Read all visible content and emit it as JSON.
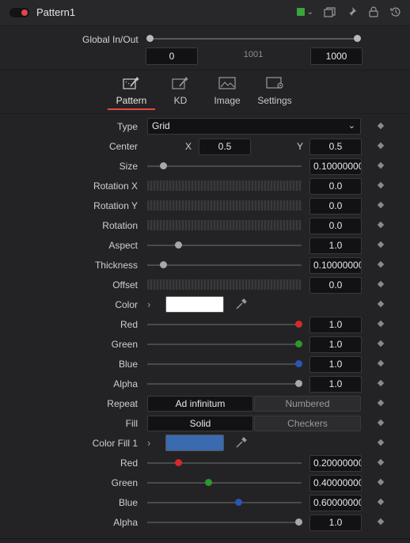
{
  "header": {
    "title": "Pattern1",
    "accent_color": "#3aa53a"
  },
  "global": {
    "label": "Global In/Out",
    "start": "0",
    "middle": "1001",
    "end": "1000"
  },
  "tabs": [
    {
      "label": "Pattern",
      "icon": "pattern-tab-icon"
    },
    {
      "label": "KD",
      "icon": "kd-tab-icon"
    },
    {
      "label": "Image",
      "icon": "image-tab-icon"
    },
    {
      "label": "Settings",
      "icon": "settings-tab-icon"
    }
  ],
  "controls": {
    "type": {
      "label": "Type",
      "value": "Grid"
    },
    "center": {
      "label": "Center",
      "x_label": "X",
      "x": "0.5",
      "y_label": "Y",
      "y": "0.5"
    },
    "size": {
      "label": "Size",
      "value": "0.100000000",
      "level": 0.1
    },
    "rotation_x": {
      "label": "Rotation X",
      "value": "0.0"
    },
    "rotation_y": {
      "label": "Rotation Y",
      "value": "0.0"
    },
    "rotation": {
      "label": "Rotation",
      "value": "0.0"
    },
    "aspect": {
      "label": "Aspect",
      "value": "1.0",
      "level": 0.2
    },
    "thickness": {
      "label": "Thickness",
      "value": "0.100000000",
      "level": 0.1
    },
    "offset": {
      "label": "Offset",
      "value": "0.0"
    },
    "color": {
      "label": "Color",
      "swatch": "#ffffff"
    },
    "red": {
      "label": "Red",
      "value": "1.0",
      "level": 1.0,
      "knob_color": "#d42a2a"
    },
    "green": {
      "label": "Green",
      "value": "1.0",
      "level": 1.0,
      "knob_color": "#2a9a2a"
    },
    "blue": {
      "label": "Blue",
      "value": "1.0",
      "level": 1.0,
      "knob_color": "#2a55b5"
    },
    "alpha": {
      "label": "Alpha",
      "value": "1.0",
      "level": 1.0,
      "knob_color": "#a8a8a8"
    },
    "repeat": {
      "label": "Repeat",
      "options": [
        "Ad infinitum",
        "Numbered"
      ],
      "selected": 0
    },
    "fill": {
      "label": "Fill",
      "options": [
        "Solid",
        "Checkers"
      ],
      "selected": 0
    },
    "color_fill": {
      "label": "Color Fill 1",
      "swatch": "#3a6ab0"
    },
    "red2": {
      "label": "Red",
      "value": "0.200000000",
      "level": 0.2,
      "knob_color": "#d42a2a"
    },
    "green2": {
      "label": "Green",
      "value": "0.400000000",
      "level": 0.4,
      "knob_color": "#2a9a2a"
    },
    "blue2": {
      "label": "Blue",
      "value": "0.600000002",
      "level": 0.6,
      "knob_color": "#2a55b5"
    },
    "alpha2": {
      "label": "Alpha",
      "value": "1.0",
      "level": 1.0,
      "knob_color": "#a8a8a8"
    }
  }
}
